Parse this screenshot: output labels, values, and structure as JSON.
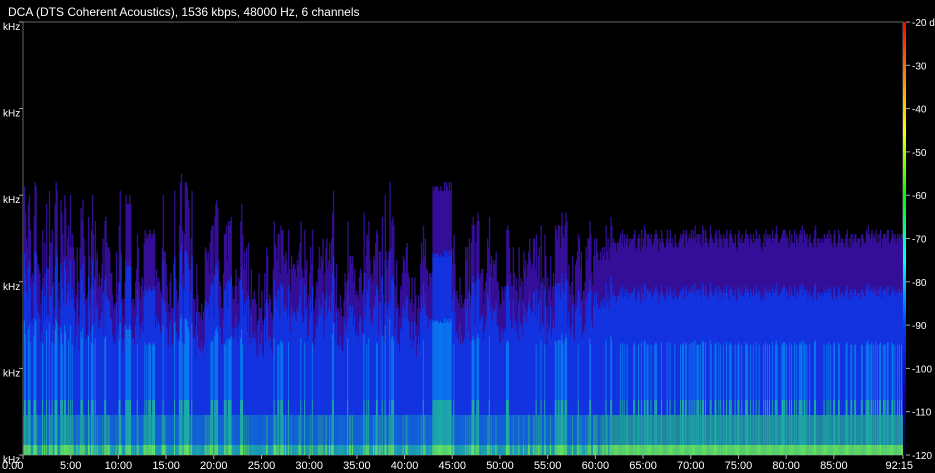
{
  "chart_data": {
    "type": "heatmap",
    "title": "DCA (DTS Coherent Acoustics), 1536 kbps, 48000 Hz, 6 channels",
    "xlabel": "",
    "ylabel": "",
    "x_ticks": [
      "0:00",
      "5:00",
      "10:00",
      "15:00",
      "20:00",
      "25:00",
      "30:00",
      "35:00",
      "40:00",
      "45:00",
      "50:00",
      "55:00",
      "60:00",
      "65:00",
      "70:00",
      "75:00",
      "80:00",
      "85:00",
      "92:15"
    ],
    "x_tick_values_min": [
      0,
      5,
      10,
      15,
      20,
      25,
      30,
      35,
      40,
      45,
      50,
      55,
      60,
      65,
      70,
      75,
      80,
      85,
      92.25
    ],
    "xlim_min": [
      0,
      92.25
    ],
    "y_ticks": [
      "kHz",
      "kHz",
      "kHz",
      "kHz",
      "kHz",
      "kHz"
    ],
    "colorbar": {
      "ticks": [
        "-20 dB",
        "-30",
        "-40",
        "-50",
        "-60",
        "-70",
        "-80",
        "-90",
        "-100",
        "-110",
        "-120"
      ],
      "values": [
        -20,
        -30,
        -40,
        -50,
        -60,
        -70,
        -80,
        -90,
        -100,
        -110,
        -120
      ],
      "range": [
        -120,
        -20
      ],
      "colors": [
        "#ff0000",
        "#ff8000",
        "#ffff00",
        "#00ff00",
        "#00ffff",
        "#0000ff",
        "#000030"
      ]
    },
    "envelope": [
      0.41,
      0.62,
      0.56,
      0.5,
      0.48,
      0.58,
      0.6,
      0.52,
      0.41,
      0.42,
      0.4,
      0.55,
      0.63,
      0.62,
      0.46,
      0.44,
      0.43,
      0.42,
      0.35,
      0.38,
      0.52,
      0.41,
      0.49,
      0.42,
      0.58,
      0.43,
      0.43,
      0.61,
      0.49,
      0.49,
      0.52,
      0.4,
      0.34,
      0.58,
      0.63,
      0.61,
      0.36,
      0.4,
      0.34,
      0.59,
      0.56,
      0.51,
      0.46,
      0.6,
      0.57,
      0.46,
      0.5,
      0.53,
      0.48,
      0.6,
      0.48,
      0.51,
      0.48,
      0.45,
      0.33,
      0.37,
      0.48,
      0.4,
      0.32,
      0.48,
      0.57,
      0.54,
      0.59,
      0.5,
      0.46,
      0.36,
      0.36,
      0.37,
      0.55,
      0.46,
      0.38,
      0.52,
      0.6,
      0.51,
      0.41,
      0.54,
      0.45,
      0.47,
      0.39,
      0.42,
      0.39,
      0.41,
      0.44,
      0.5,
      0.37,
      0.54,
      0.55,
      0.49,
      0.48,
      0.48,
      0.47,
      0.42,
      0.42,
      0.37,
      0.34,
      0.35,
      0.34,
      0.47,
      0.37,
      0.4,
      0.53,
      0.61,
      0.47,
      0.36,
      0.32,
      0.36,
      0.4,
      0.6,
      0.58,
      0.58,
      0.58,
      0.6,
      0.58,
      0.35,
      0.36,
      0.36,
      0.34,
      0.4,
      0.43,
      0.51,
      0.48,
      0.4,
      0.36,
      0.39,
      0.41,
      0.38,
      0.49,
      0.52,
      0.5,
      0.51,
      0.5,
      0.51,
      0.52,
      0.51,
      0.5,
      0.51,
      0.52,
      0.51,
      0.39,
      0.43,
      0.4,
      0.41,
      0.4,
      0.38,
      0.37,
      0.48,
      0.6,
      0.47,
      0.47,
      0.44,
      0.39,
      0.35,
      0.33,
      0.4,
      0.42,
      0.34,
      0.34,
      0.44,
      0.61,
      0.41,
      0.38,
      0.35,
      0.36,
      0.53,
      0.63,
      0.65,
      0.52,
      0.42,
      0.51,
      0.63,
      0.63,
      0.62,
      0.59,
      0.57,
      0.43,
      0.5,
      0.61,
      0.37,
      0.36,
      0.36,
      0.3,
      0.44,
      0.37,
      0.33,
      0.33,
      0.32,
      0.35,
      0.31,
      0.33,
      0.34,
      0.48,
      0.47,
      0.45,
      0.47,
      0.42,
      0.49,
      0.52,
      0.53,
      0.53,
      0.42,
      0.55,
      0.58,
      0.59,
      0.57,
      0.45,
      0.4,
      0.39,
      0.34,
      0.34,
      0.42,
      0.51,
      0.51,
      0.53,
      0.45,
      0.54,
      0.53,
      0.54,
      0.55,
      0.39,
      0.36,
      0.36,
      0.39,
      0.43,
      0.39,
      0.35,
      0.41,
      0.4,
      0.54,
      0.58,
      0.51,
      0.43,
      0.47,
      0.43,
      0.48,
      0.38,
      0.49,
      0.36,
      0.34,
      0.43,
      0.36,
      0.36,
      0.38,
      0.36,
      0.35,
      0.3,
      0.31,
      0.42,
      0.34,
      0.34,
      0.38,
      0.31,
      0.3,
      0.42,
      0.35,
      0.48,
      0.46,
      0.35,
      0.37,
      0.36,
      0.33,
      0.31,
      0.43,
      0.54,
      0.49,
      0.48,
      0.45,
      0.51,
      0.51,
      0.42,
      0.53,
      0.52,
      0.52,
      0.46,
      0.44,
      0.47,
      0.45,
      0.42,
      0.52,
      0.43,
      0.38,
      0.46,
      0.43,
      0.44,
      0.44,
      0.43,
      0.41,
      0.45,
      0.44,
      0.47,
      0.49,
      0.54,
      0.43,
      0.41,
      0.41,
      0.52,
      0.43,
      0.45,
      0.35,
      0.37,
      0.42,
      0.48,
      0.44,
      0.52,
      0.33,
      0.34,
      0.36,
      0.4,
      0.39,
      0.43,
      0.48,
      0.43,
      0.46,
      0.45,
      0.5,
      0.36,
      0.42,
      0.48,
      0.5,
      0.43,
      0.45,
      0.49,
      0.44,
      0.5,
      0.56,
      0.61,
      0.41,
      0.35,
      0.44,
      0.34,
      0.34,
      0.33,
      0.37,
      0.34,
      0.32,
      0.32,
      0.36,
      0.42,
      0.4,
      0.38,
      0.54,
      0.42,
      0.46,
      0.46,
      0.44,
      0.46,
      0.4,
      0.43,
      0.37,
      0.38,
      0.37,
      0.36,
      0.41,
      0.43,
      0.42,
      0.37,
      0.38,
      0.56,
      0.42,
      0.46,
      0.51,
      0.5,
      0.54,
      0.45,
      0.41,
      0.42,
      0.4,
      0.46,
      0.45,
      0.49,
      0.52,
      0.51,
      0.37,
      0.47,
      0.47,
      0.41,
      0.55,
      0.37,
      0.35,
      0.6,
      0.47,
      0.43,
      0.45,
      0.47,
      0.63,
      0.48,
      0.54,
      0.55,
      0.53,
      0.37,
      0.39,
      0.45,
      0.35,
      0.34,
      0.32,
      0.39,
      0.38,
      0.42,
      0.46,
      0.45,
      0.42,
      0.48,
      0.49,
      0.42,
      0.41,
      0.35,
      0.36,
      0.41,
      0.33,
      0.35,
      0.41,
      0.37,
      0.3,
      0.34,
      0.37,
      0.34,
      0.44,
      0.49,
      0.45,
      0.53,
      0.46,
      0.5,
      0.43,
      0.43,
      0.39,
      0.42,
      0.42,
      0.41,
      0.42,
      0.62,
      0.61,
      0.62,
      0.62,
      0.62,
      0.62,
      0.61,
      0.61,
      0.62,
      0.61,
      0.61,
      0.61,
      0.63,
      0.61,
      0.63,
      0.62,
      0.61,
      0.63,
      0.61,
      0.63,
      0.44,
      0.48,
      0.51,
      0.44,
      0.37,
      0.38,
      0.36,
      0.35,
      0.41,
      0.34,
      0.37,
      0.34,
      0.35,
      0.36,
      0.48,
      0.45,
      0.48,
      0.38,
      0.5,
      0.35,
      0.49,
      0.53,
      0.55,
      0.53,
      0.4,
      0.49,
      0.54,
      0.56,
      0.54,
      0.41,
      0.42,
      0.43,
      0.43,
      0.35,
      0.38,
      0.4,
      0.42,
      0.5,
      0.48,
      0.55,
      0.44,
      0.46,
      0.41,
      0.45,
      0.44,
      0.45,
      0.47,
      0.4,
      0.4,
      0.38,
      0.34,
      0.35,
      0.39,
      0.38,
      0.36,
      0.39,
      0.38,
      0.52,
      0.53,
      0.52,
      0.48,
      0.42,
      0.39,
      0.39,
      0.48,
      0.42,
      0.38,
      0.41,
      0.38,
      0.35,
      0.48,
      0.39,
      0.41,
      0.4,
      0.36,
      0.47,
      0.43,
      0.45,
      0.41,
      0.44,
      0.47,
      0.5,
      0.45,
      0.43,
      0.44,
      0.5,
      0.5,
      0.43,
      0.51,
      0.41,
      0.46,
      0.48,
      0.38,
      0.53,
      0.4,
      0.41,
      0.39,
      0.51,
      0.46,
      0.34,
      0.41,
      0.38,
      0.39,
      0.46,
      0.36,
      0.39,
      0.42,
      0.39,
      0.53,
      0.52,
      0.5,
      0.53,
      0.53,
      0.48,
      0.53,
      0.56,
      0.51,
      0.5,
      0.53,
      0.56,
      0.54,
      0.4,
      0.44,
      0.39,
      0.37,
      0.4,
      0.46,
      0.37,
      0.35,
      0.44,
      0.45,
      0.47,
      0.51,
      0.5,
      0.43,
      0.47,
      0.36,
      0.38,
      0.38,
      0.4,
      0.48,
      0.45,
      0.5,
      0.5,
      0.54,
      0.51,
      0.42,
      0.39,
      0.46,
      0.5,
      0.46,
      0.5,
      0.47,
      0.45,
      0.45,
      0.47,
      0.45,
      0.48,
      0.46,
      0.48,
      0.45,
      0.53,
      0.47,
      0.5,
      0.45,
      0.48,
      0.55,
      0.53,
      0.49,
      0.5,
      0.49,
      0.49,
      0.47,
      0.49,
      0.49,
      0.5,
      0.51,
      0.49,
      0.52,
      0.48,
      0.51,
      0.49,
      0.5,
      0.51,
      0.48,
      0.5,
      0.49,
      0.5,
      0.5,
      0.5,
      0.51,
      0.52,
      0.47,
      0.48,
      0.5,
      0.51,
      0.5,
      0.47,
      0.52,
      0.48,
      0.5,
      0.53,
      0.52,
      0.48,
      0.51,
      0.51,
      0.5,
      0.5,
      0.51,
      0.48,
      0.49,
      0.5,
      0.51,
      0.52,
      0.51,
      0.5,
      0.47,
      0.5,
      0.49,
      0.52,
      0.5,
      0.49,
      0.48,
      0.48,
      0.5,
      0.52,
      0.49,
      0.5,
      0.52,
      0.49,
      0.5,
      0.48,
      0.48,
      0.51,
      0.49,
      0.48,
      0.48,
      0.49,
      0.5,
      0.51,
      0.5,
      0.51,
      0.52,
      0.48,
      0.51,
      0.52,
      0.49,
      0.5,
      0.51,
      0.5,
      0.52,
      0.5,
      0.52,
      0.5,
      0.53,
      0.49,
      0.51,
      0.51,
      0.51,
      0.49,
      0.51,
      0.48,
      0.53,
      0.52,
      0.49,
      0.52,
      0.5,
      0.49,
      0.48,
      0.5,
      0.53,
      0.51,
      0.5,
      0.49,
      0.49,
      0.51,
      0.52,
      0.5,
      0.48,
      0.52,
      0.5,
      0.51,
      0.5,
      0.48,
      0.51,
      0.5,
      0.5,
      0.52,
      0.5,
      0.48,
      0.51,
      0.52,
      0.51,
      0.5,
      0.49,
      0.49,
      0.51,
      0.48,
      0.47,
      0.51,
      0.52,
      0.49,
      0.5,
      0.51,
      0.49,
      0.49,
      0.5,
      0.52,
      0.51,
      0.51,
      0.5,
      0.48,
      0.51,
      0.5,
      0.49,
      0.51,
      0.49,
      0.5,
      0.52,
      0.5,
      0.5,
      0.51,
      0.5,
      0.48,
      0.47,
      0.49,
      0.51,
      0.48,
      0.52,
      0.5,
      0.51,
      0.5,
      0.51,
      0.5,
      0.49,
      0.52,
      0.5,
      0.5,
      0.51,
      0.53,
      0.51,
      0.49,
      0.49,
      0.5,
      0.5,
      0.51,
      0.52,
      0.52,
      0.52,
      0.5,
      0.51,
      0.5,
      0.48,
      0.52,
      0.49,
      0.51,
      0.49,
      0.49,
      0.52,
      0.48,
      0.51,
      0.5,
      0.49,
      0.51,
      0.52,
      0.51,
      0.53,
      0.49,
      0.52,
      0.51,
      0.5,
      0.51,
      0.48,
      0.5,
      0.51,
      0.49,
      0.49,
      0.48,
      0.5,
      0.52,
      0.53,
      0.48,
      0.5,
      0.5,
      0.49,
      0.5,
      0.49,
      0.5,
      0.49,
      0.51,
      0.5,
      0.5,
      0.51,
      0.5,
      0.52,
      0.5,
      0.51,
      0.49,
      0.48,
      0.51,
      0.52,
      0.49,
      0.48,
      0.49,
      0.52,
      0.51,
      0.49,
      0.5,
      0.5,
      0.49,
      0.48,
      0.5,
      0.51,
      0.52,
      0.48,
      0.5,
      0.48,
      0.51,
      0.51,
      0.49,
      0.5,
      0.51,
      0.51,
      0.49,
      0.5,
      0.5,
      0.5,
      0.48,
      0.51,
      0.51,
      0.5,
      0.49,
      0.49,
      0.52,
      0.51,
      0.53,
      0.51,
      0.5,
      0.51,
      0.52,
      0.5,
      0.51,
      0.5,
      0.52,
      0.49,
      0.51,
      0.49,
      0.51,
      0.52,
      0.48,
      0.5,
      0.51,
      0.51,
      0.51,
      0.5,
      0.52,
      0.52,
      0.49,
      0.49,
      0.5,
      0.52,
      0.51,
      0.5,
      0.51,
      0.49,
      0.5,
      0.51,
      0.5,
      0.51,
      0.5,
      0.51,
      0.5
    ]
  }
}
